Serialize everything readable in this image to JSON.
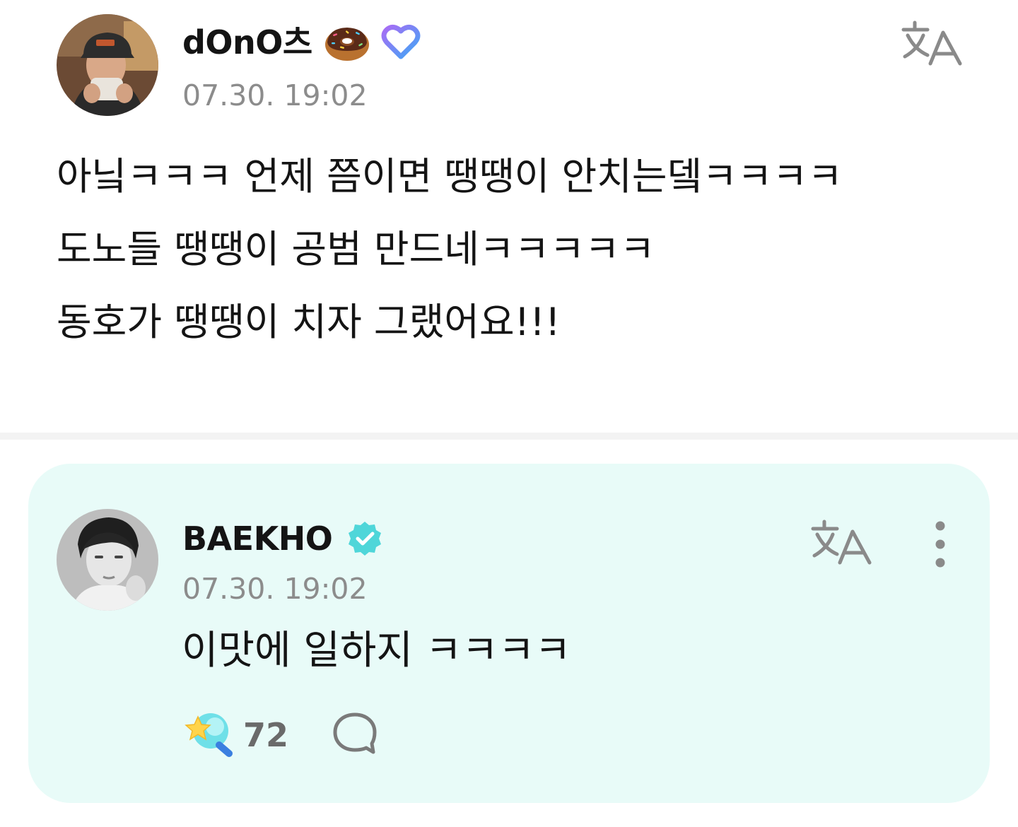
{
  "post": {
    "author": "dOnO츠",
    "author_emoji_icon": "donut-icon",
    "badge_icon": "fan-heart-badge-icon",
    "timestamp": "07.30. 19:02",
    "lines": [
      "아닠ㅋㅋㅋ 언제 쯤이면 땡땡이 안치는뎈ㅋㅋㅋㅋ",
      "도노들 땡땡이 공범 만드네ㅋㅋㅋㅋㅋ",
      "동호가 땡땡이 치자 그랬어요!!!"
    ],
    "translate_icon": "translate-icon"
  },
  "reply": {
    "author": "BAEKHO",
    "badge_icon": "verified-badge-icon",
    "timestamp": "07.30. 19:02",
    "text": "이맛에 일하지 ㅋㅋㅋㅋ",
    "like_count": "72",
    "like_icon": "lightstick-like-icon",
    "comment_icon": "comment-bubble-icon",
    "more_icon": "more-vertical-icon",
    "translate_icon": "translate-icon"
  },
  "colors": {
    "card_background": "#e8fbf8",
    "verified_badge": "#4fd6d9",
    "timestamp": "#8c8c8c"
  }
}
